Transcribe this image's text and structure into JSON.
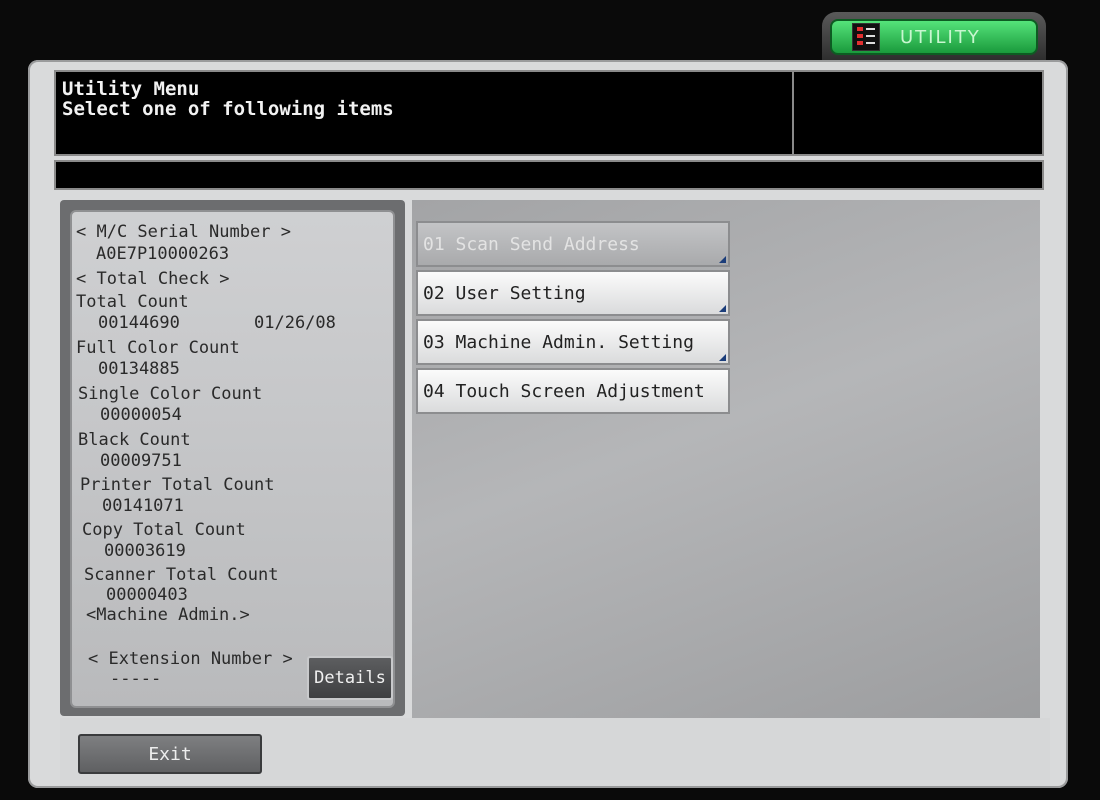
{
  "tab": {
    "label": "UTILITY"
  },
  "header": {
    "title": "Utility Menu",
    "subtitle": "Select one of following items"
  },
  "machine_info": {
    "serial_heading": "< M/C Serial Number >",
    "serial_value": "A0E7P10000263",
    "total_check_heading": "< Total Check >",
    "total_count_label": "Total Count",
    "total_count_value": "00144690",
    "date": "01/26/08",
    "full_color_label": "Full Color Count",
    "full_color_value": "00134885",
    "single_color_label": "Single Color Count",
    "single_color_value": "00000054",
    "black_label": "Black Count",
    "black_value": "00009751",
    "printer_total_label": "Printer Total Count",
    "printer_total_value": "00141071",
    "copy_total_label": "Copy Total Count",
    "copy_total_value": "00003619",
    "scanner_total_label": "Scanner Total Count",
    "scanner_total_value": "00000403",
    "machine_admin": "<Machine Admin.>",
    "extension_heading": "< Extension Number >",
    "extension_value": "-----",
    "details_label": "Details"
  },
  "menu": {
    "items": [
      {
        "label": "01 Scan Send Address",
        "enabled": false
      },
      {
        "label": "02 User Setting",
        "enabled": true
      },
      {
        "label": "03 Machine Admin. Setting",
        "enabled": true
      },
      {
        "label": "04 Touch Screen Adjustment",
        "enabled": true
      }
    ]
  },
  "footer": {
    "exit_label": "Exit"
  },
  "colors": {
    "tab_green": "#2fbf55",
    "screen_bg": "#d9dadb",
    "message_bg": "#000000",
    "button_face": "#f4f4f4"
  }
}
